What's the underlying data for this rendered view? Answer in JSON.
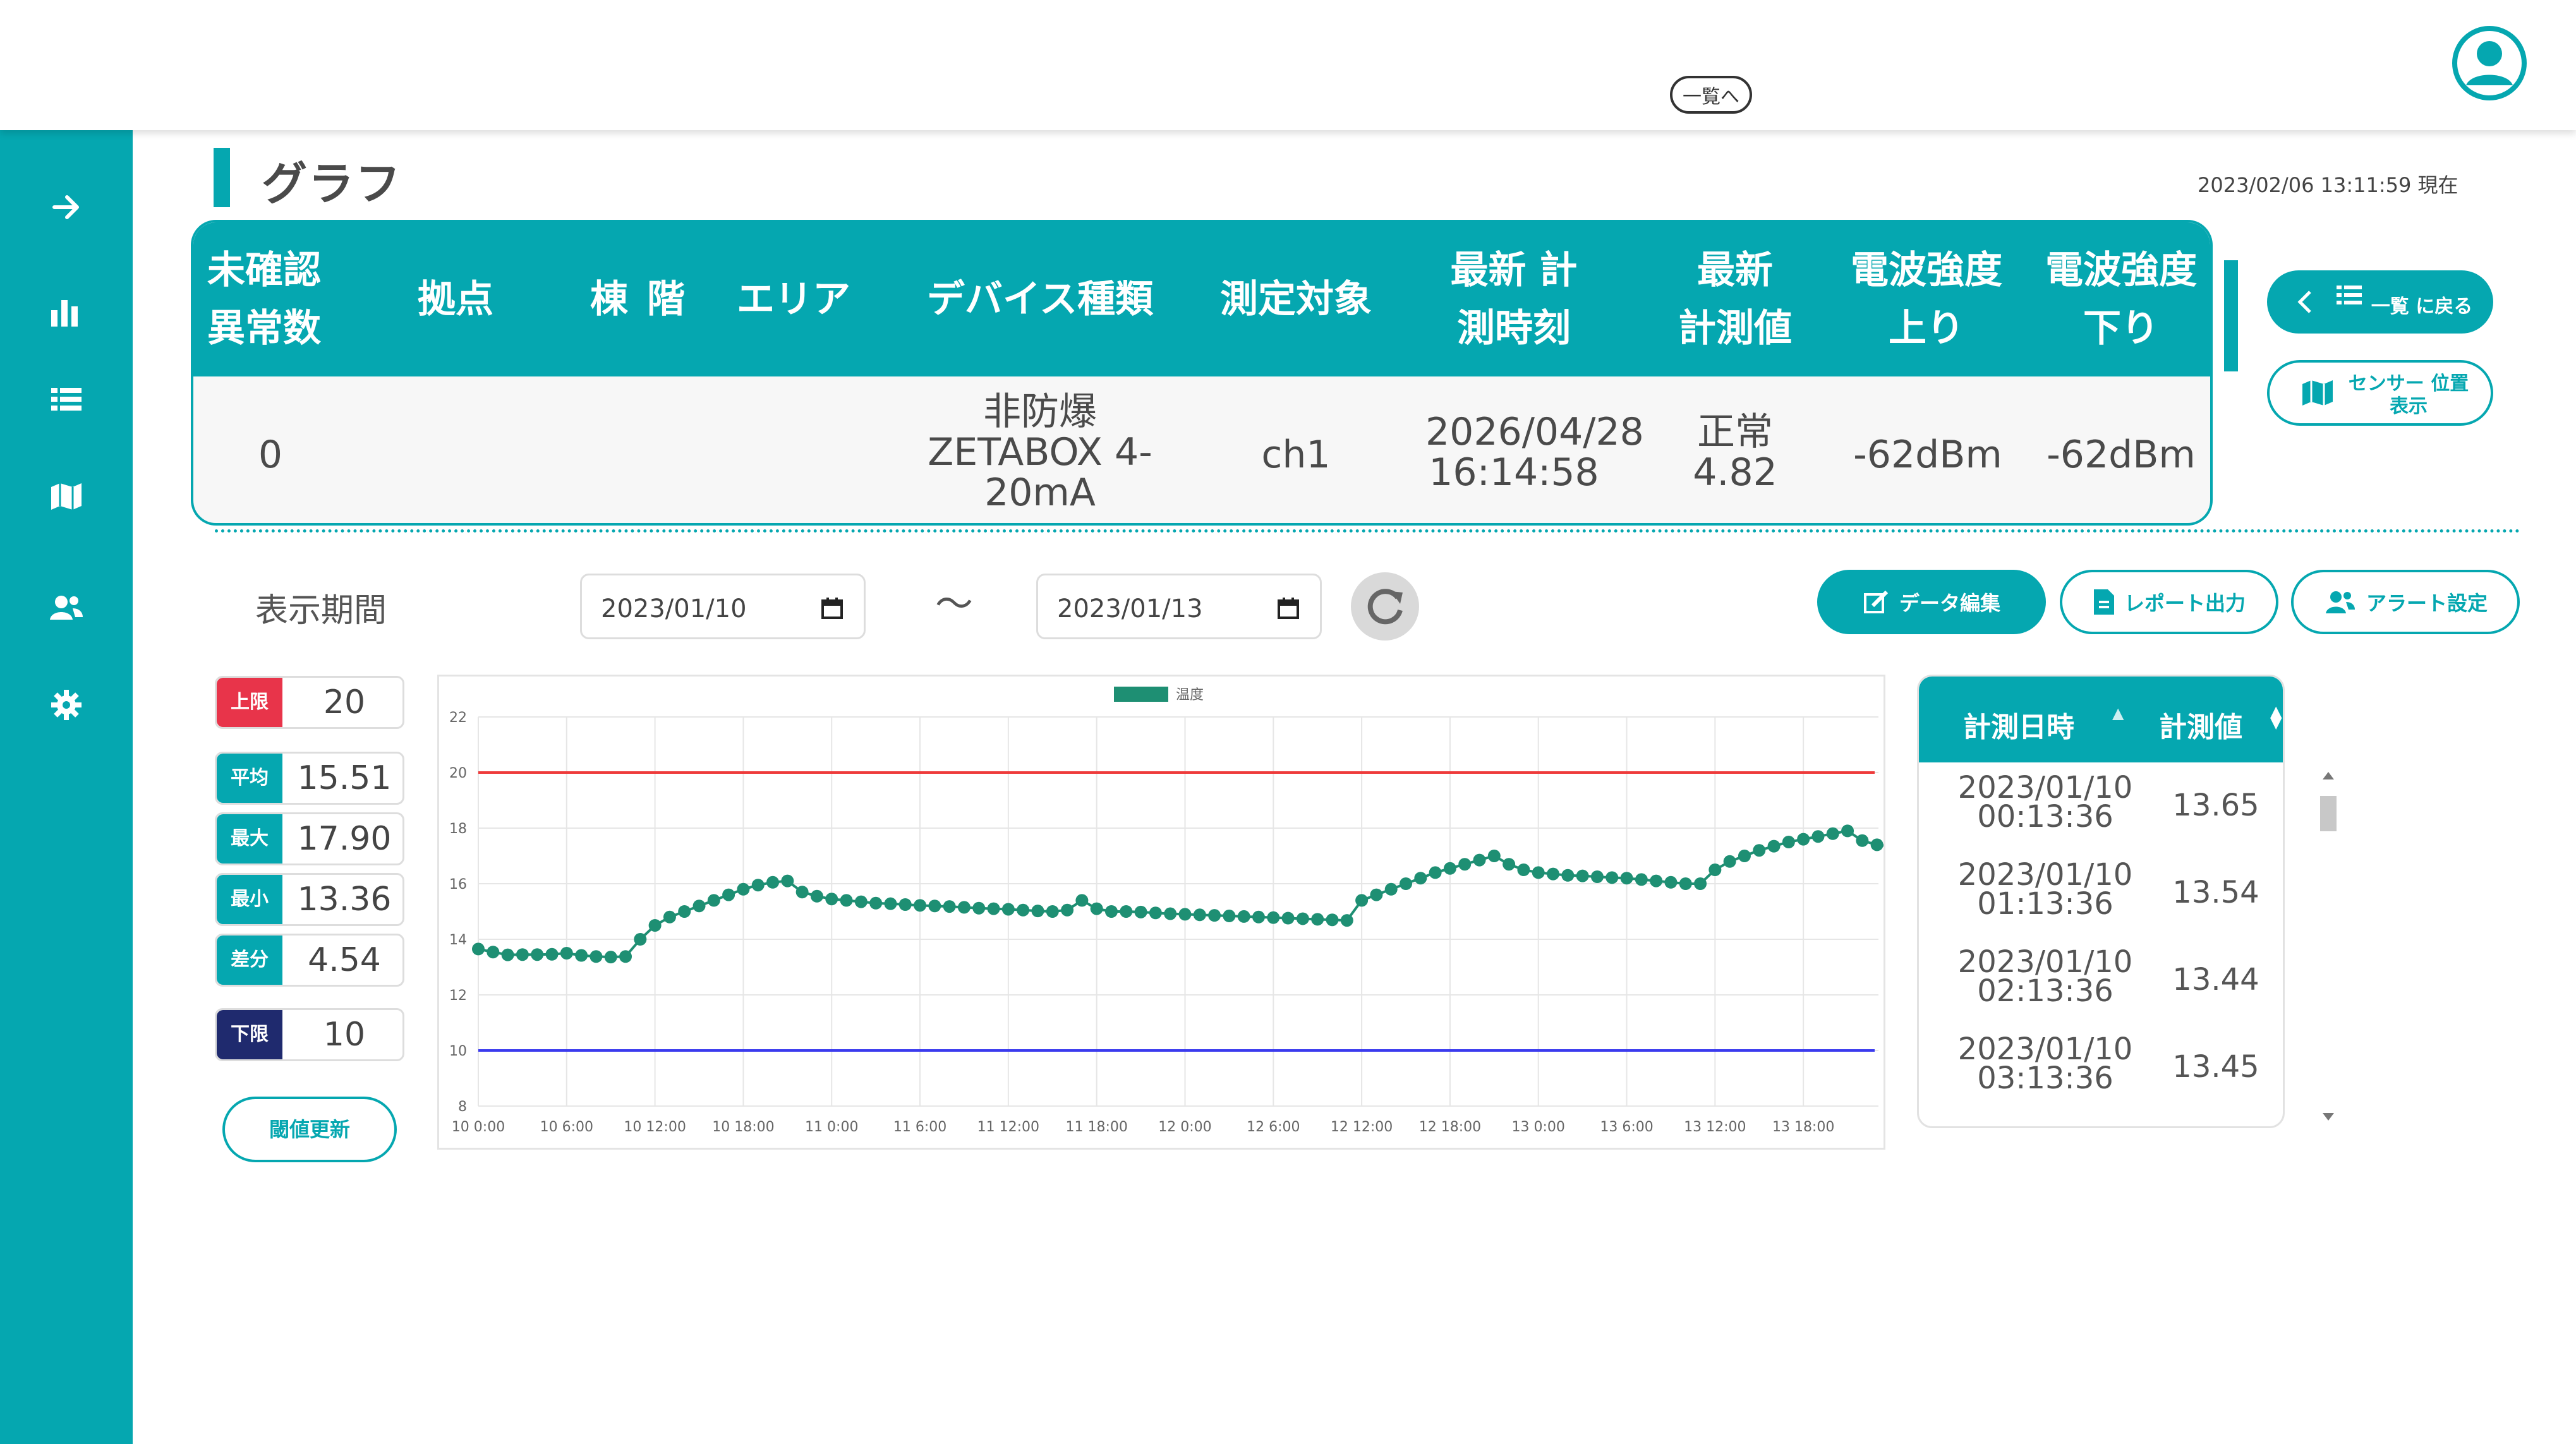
{
  "header": {
    "list_button": "一覧へ"
  },
  "page": {
    "title": "グラフ",
    "datetime": "2023/02/06 13:11:59 現在"
  },
  "sidebar": {
    "items": [
      {
        "icon": "arrow-right-icon"
      },
      {
        "icon": "bar-chart-icon"
      },
      {
        "icon": "list-icon"
      },
      {
        "icon": "map-icon"
      },
      {
        "icon": "users-icon"
      },
      {
        "icon": "gear-icon"
      }
    ]
  },
  "summary": {
    "headers": {
      "unconfirmed": "未確認 異常数",
      "site": "拠点",
      "building": "棟",
      "floor": "階",
      "area": "エリア",
      "device_type": "デバイス種類",
      "target": "測定対象",
      "latest_time": "最新 計測時刻",
      "latest_value": "最新 計測値",
      "signal_up": "電波強度 上り",
      "signal_down": "電波強度 下り"
    },
    "row": {
      "unconfirmed": "0",
      "site": "",
      "building": "",
      "floor": "",
      "area": "",
      "device_type": "非防爆 ZETABOX 4-20mA",
      "target": "ch1",
      "latest_time": "2026/04/28 16:14:58",
      "latest_value": "正常 4.82",
      "signal_up": "-62dBm",
      "signal_down": "-62dBm"
    }
  },
  "side_buttons": {
    "back": "一覧 に戻る",
    "sensor": "センサー 位置表示"
  },
  "controls": {
    "period_label": "表示期間",
    "start_date": "2023/01/10",
    "tilde": "〜",
    "end_date": "2023/01/13",
    "edit_button": "データ編集",
    "report_button": "レポート出力",
    "alert_button": "アラート設定"
  },
  "stats": {
    "upper_label": "上限",
    "upper": "20",
    "avg_label": "平均",
    "avg": "15.51",
    "max_label": "最大",
    "max": "17.90",
    "min_label": "最小",
    "min": "13.36",
    "diff_label": "差分",
    "diff": "4.54",
    "lower_label": "下限",
    "lower": "10",
    "update_button": "閾値更新"
  },
  "colors": {
    "accent": "#05a7b0",
    "upper_tag": "#e8344a",
    "lower_tag": "#1f2a6e",
    "series": "#1e8f73",
    "upper_line": "#ee3b3b",
    "lower_line": "#3b3bee"
  },
  "chart_data": {
    "type": "line",
    "legend": [
      "温度"
    ],
    "ylim": [
      8,
      22
    ],
    "yticks": [
      8,
      10,
      12,
      14,
      16,
      18,
      20,
      22
    ],
    "xticks": [
      "10 0:00",
      "10 6:00",
      "10 12:00",
      "10 18:00",
      "11 0:00",
      "11 6:00",
      "11 12:00",
      "11 18:00",
      "12 0:00",
      "12 6:00",
      "12 12:00",
      "12 18:00",
      "13 0:00",
      "13 6:00",
      "13 12:00",
      "13 18:00"
    ],
    "xmax_hours": 96,
    "upper_limit": 20,
    "lower_limit": 10,
    "series": [
      {
        "name": "温度",
        "values": [
          13.65,
          13.54,
          13.44,
          13.45,
          13.45,
          13.46,
          13.5,
          13.42,
          13.38,
          13.36,
          13.38,
          14.0,
          14.5,
          14.8,
          15.0,
          15.2,
          15.4,
          15.6,
          15.8,
          15.95,
          16.05,
          16.1,
          15.7,
          15.55,
          15.45,
          15.4,
          15.35,
          15.3,
          15.28,
          15.25,
          15.22,
          15.2,
          15.18,
          15.15,
          15.12,
          15.1,
          15.08,
          15.05,
          15.02,
          15.0,
          15.05,
          15.4,
          15.1,
          15.0,
          15.0,
          14.98,
          14.95,
          14.92,
          14.9,
          14.88,
          14.86,
          14.84,
          14.82,
          14.8,
          14.78,
          14.76,
          14.74,
          14.72,
          14.7,
          14.68,
          15.4,
          15.6,
          15.8,
          16.0,
          16.2,
          16.4,
          16.55,
          16.7,
          16.85,
          17.0,
          16.7,
          16.5,
          16.4,
          16.35,
          16.3,
          16.28,
          16.25,
          16.22,
          16.2,
          16.15,
          16.1,
          16.05,
          16.0,
          16.0,
          16.5,
          16.8,
          17.0,
          17.2,
          17.35,
          17.5,
          17.6,
          17.7,
          17.8,
          17.9,
          17.55,
          17.4,
          17.35
        ]
      }
    ]
  },
  "data_table": {
    "header_date": "計測日時",
    "header_value": "計測値",
    "rows": [
      {
        "date": "2023/01/10",
        "time": "00:13:36",
        "value": "13.65"
      },
      {
        "date": "2023/01/10",
        "time": "01:13:36",
        "value": "13.54"
      },
      {
        "date": "2023/01/10",
        "time": "02:13:36",
        "value": "13.44"
      },
      {
        "date": "2023/01/10",
        "time": "03:13:36",
        "value": "13.45"
      }
    ]
  }
}
